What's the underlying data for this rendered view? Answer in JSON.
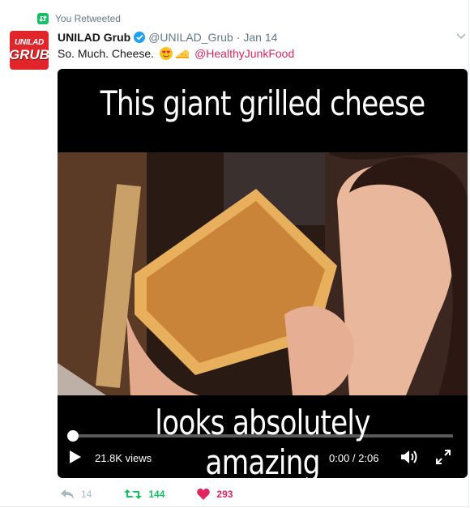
{
  "context": {
    "label": "You Retweeted"
  },
  "tweet": {
    "avatar_line1": "UNILAD",
    "avatar_line2": "GRUB",
    "name": "UNILAD Grub",
    "handle": "@UNILAD_Grub",
    "separator": "·",
    "date": "Jan 14",
    "text": "So. Much. Cheese.",
    "mention": "@HealthyJunkFood"
  },
  "media": {
    "caption_top": "This giant grilled cheese",
    "caption_bottom": "looks absolutely amazing",
    "views": "21.8K views",
    "time": "0:00 / 2:06",
    "progress_fraction": 0.0
  },
  "actions": {
    "replies": "14",
    "retweets": "144",
    "likes": "293"
  },
  "colors": {
    "retweet_green": "#17bf63",
    "like_red": "#e0245e",
    "verified_blue": "#1da1f2",
    "brand_red": "#e0262b"
  },
  "icons": [
    "retweet-icon",
    "verified-icon",
    "caret-down-icon",
    "play-icon",
    "volume-icon",
    "fullscreen-icon",
    "reply-icon",
    "heart-icon"
  ]
}
